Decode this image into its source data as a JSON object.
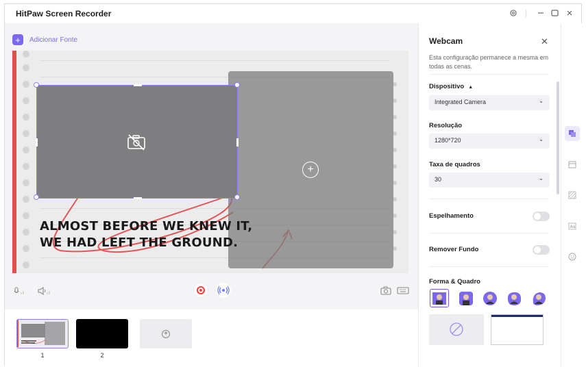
{
  "app": {
    "title": "HitPaw Screen Recorder"
  },
  "window_controls": {
    "settings_icon": "gear-icon",
    "min_icon": "minimize-icon",
    "max_icon": "maximize-icon",
    "close_icon": "close-icon"
  },
  "toolbar": {
    "add_source_label": "Adicionar Fonte"
  },
  "canvas": {
    "headline_line1": "ALMOST BEFORE WE KNEW IT,",
    "headline_line2": "WE HAD LEFT THE GROUND.",
    "accent_color": "#7b68ee",
    "red_bar_color": "#e94a4a"
  },
  "scenes": {
    "items": [
      {
        "number": "1"
      },
      {
        "number": "2"
      }
    ]
  },
  "panel": {
    "title": "Webcam",
    "description": "Esta configuração permanece a mesma em todas as cenas.",
    "device": {
      "label": "Dispositivo",
      "value": "Integrated Camera"
    },
    "resolution": {
      "label": "Resolução",
      "value": "1280*720"
    },
    "fps": {
      "label": "Taxa de quadros",
      "value": "30"
    },
    "mirror": {
      "label": "Espelhamento",
      "on": false
    },
    "remove_bg": {
      "label": "Remover Fundo",
      "on": false
    },
    "shape_frame": {
      "label": "Forma & Quadro"
    }
  }
}
